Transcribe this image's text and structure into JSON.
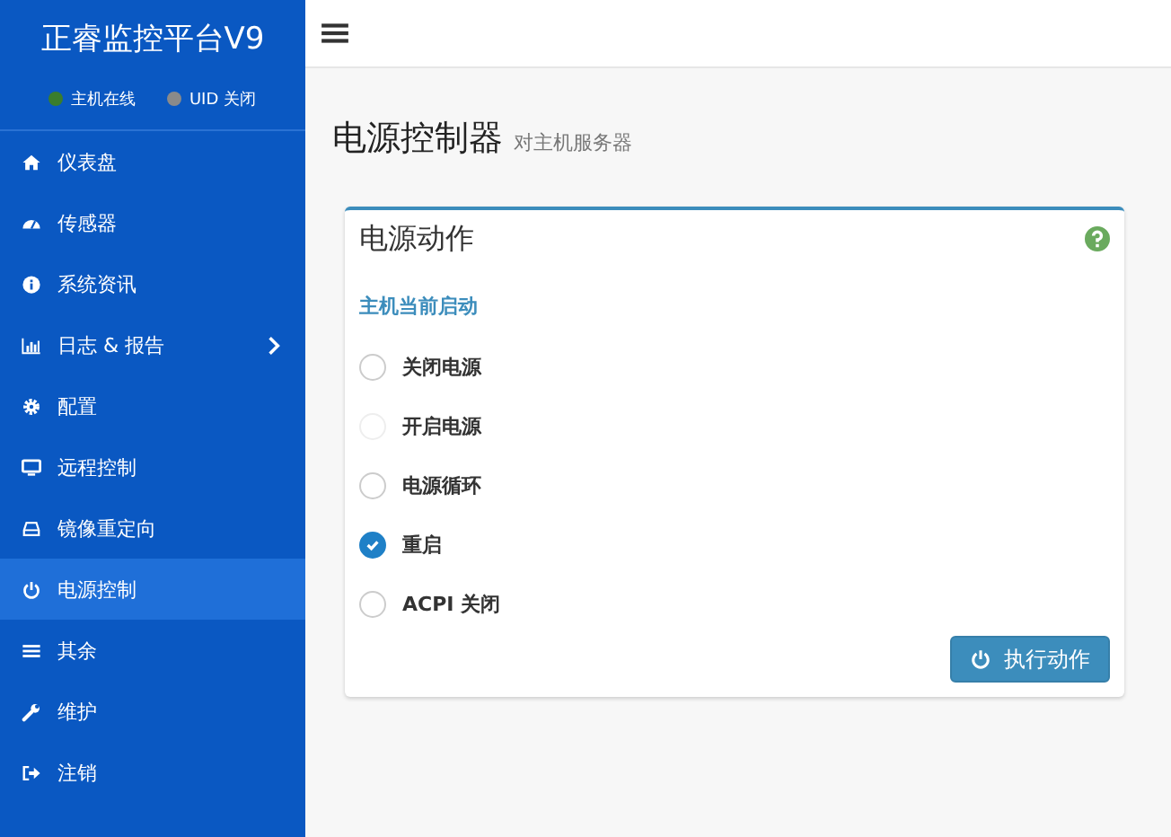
{
  "sidebar": {
    "title": "正睿监控平台V9",
    "status": [
      {
        "label": "主机在线",
        "color": "#3a7d2c"
      },
      {
        "label": "UID 关闭",
        "color": "#8a8a8a"
      }
    ],
    "items": [
      {
        "label": "仪表盘",
        "selected": false,
        "submenu": false
      },
      {
        "label": "传感器",
        "selected": false,
        "submenu": false
      },
      {
        "label": "系统资讯",
        "selected": false,
        "submenu": false
      },
      {
        "label": "日志 & 报告",
        "selected": false,
        "submenu": true
      },
      {
        "label": "配置",
        "selected": false,
        "submenu": false
      },
      {
        "label": "远程控制",
        "selected": false,
        "submenu": false
      },
      {
        "label": "镜像重定向",
        "selected": false,
        "submenu": false
      },
      {
        "label": "电源控制",
        "selected": true,
        "submenu": false
      },
      {
        "label": "其余",
        "selected": false,
        "submenu": false
      },
      {
        "label": "维护",
        "selected": false,
        "submenu": false
      },
      {
        "label": "注销",
        "selected": false,
        "submenu": false
      }
    ]
  },
  "page": {
    "title": "电源控制器",
    "subtitle": "对主机服务器"
  },
  "card": {
    "title": "电源动作",
    "section": "主机当前启动",
    "options": [
      {
        "label": "关闭电源",
        "selected": false,
        "disabled": false
      },
      {
        "label": "开启电源",
        "selected": false,
        "disabled": true
      },
      {
        "label": "电源循环",
        "selected": false,
        "disabled": false
      },
      {
        "label": "重启",
        "selected": true,
        "disabled": false
      },
      {
        "label": "ACPI 关闭",
        "selected": false,
        "disabled": false
      }
    ],
    "button": "执行动作"
  }
}
